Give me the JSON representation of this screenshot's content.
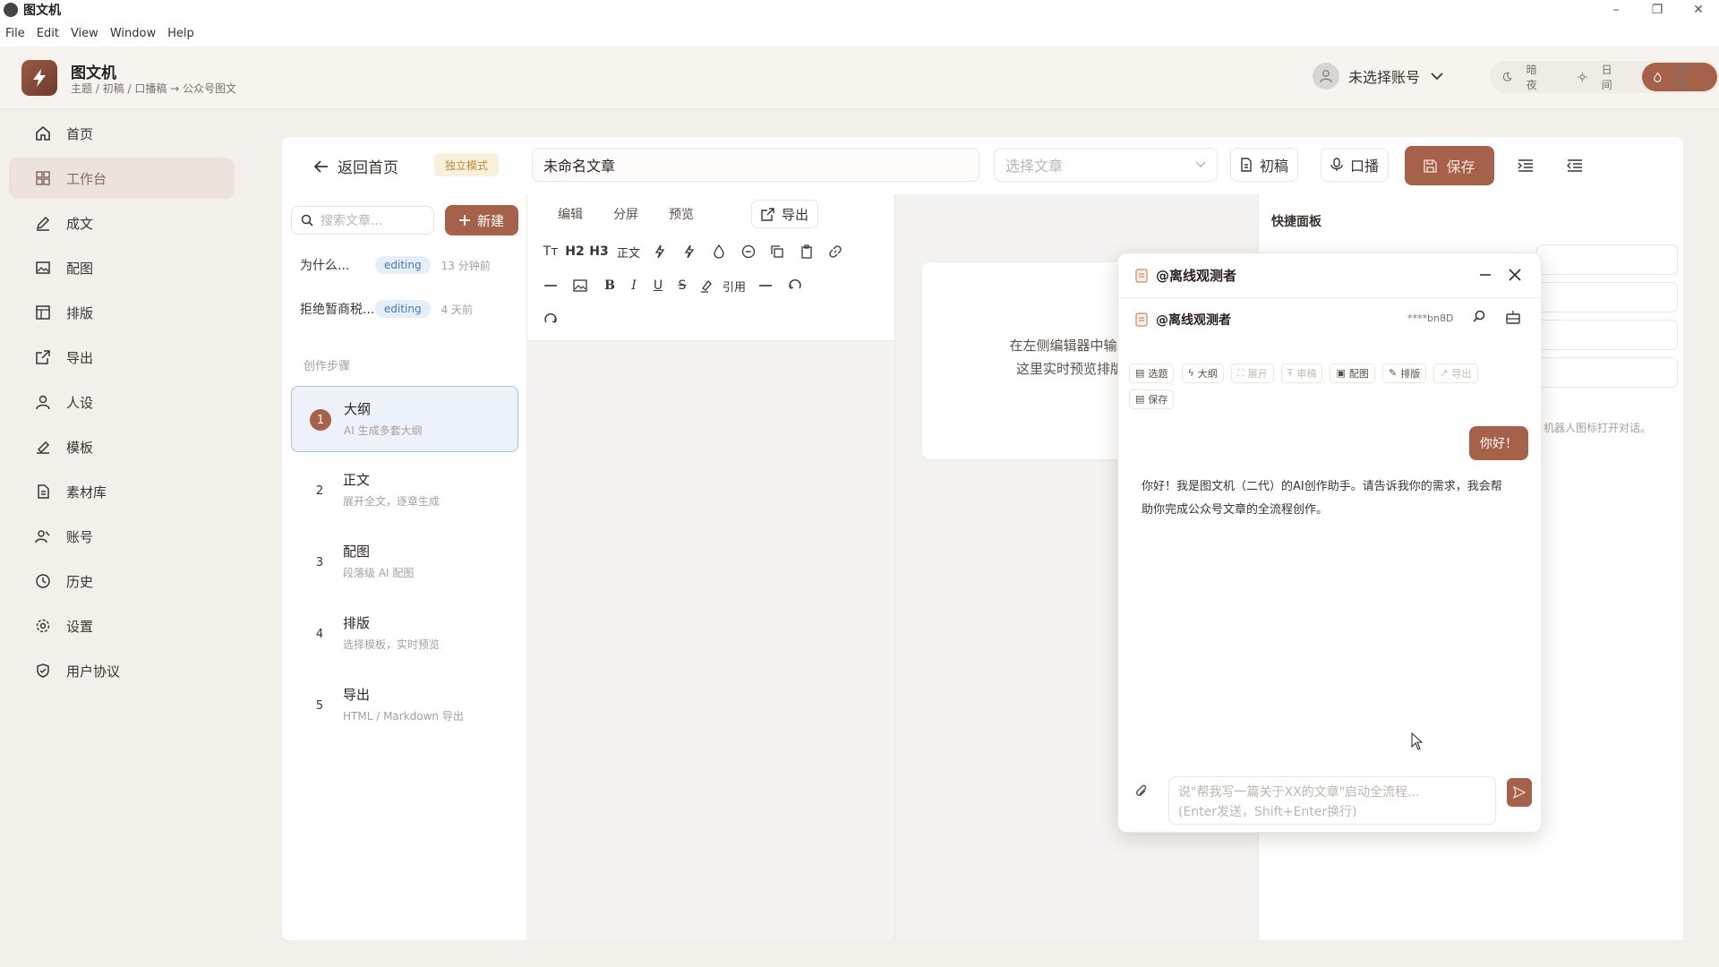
{
  "window": {
    "title": "图文机",
    "minimize": "–",
    "maximize": "❐",
    "close": "✕"
  },
  "menu": [
    "File",
    "Edit",
    "View",
    "Window",
    "Help"
  ],
  "header": {
    "brand": "图文机",
    "breadcrumb": "主题 / 初稿 / 口播稿 → 公众号图文",
    "account": "未选择账号",
    "themes": [
      "暗夜",
      "日间",
      "暖阳"
    ],
    "active_theme": "暖阳"
  },
  "sidebar": {
    "items": [
      {
        "label": "首页",
        "icon": "home-icon"
      },
      {
        "label": "工作台",
        "icon": "grid-icon"
      },
      {
        "label": "成文",
        "icon": "pen-icon"
      },
      {
        "label": "配图",
        "icon": "image-icon"
      },
      {
        "label": "排版",
        "icon": "layout-icon"
      },
      {
        "label": "导出",
        "icon": "export-icon"
      },
      {
        "label": "人设",
        "icon": "person-icon"
      },
      {
        "label": "模板",
        "icon": "template-icon"
      },
      {
        "label": "素材库",
        "icon": "document-icon"
      },
      {
        "label": "账号",
        "icon": "account-icon"
      },
      {
        "label": "历史",
        "icon": "clock-icon"
      },
      {
        "label": "设置",
        "icon": "gear-icon"
      },
      {
        "label": "用户协议",
        "icon": "shield-icon"
      }
    ],
    "active": "工作台"
  },
  "toolbar": {
    "back": "返回首页",
    "mode_badge": "独立模式",
    "title_value": "未命名文章",
    "select_placeholder": "选择文章",
    "draft": "初稿",
    "voice": "口播",
    "save": "保存"
  },
  "articles": {
    "search_placeholder": "搜索文章...",
    "new": "新建",
    "list": [
      {
        "title": "为什么...",
        "status": "editing",
        "time": "13 分钟前"
      },
      {
        "title": "拒绝暂商税...",
        "status": "editing",
        "time": "4 天前"
      }
    ],
    "steps_label": "创作步骤",
    "steps": [
      {
        "num": "1",
        "title": "大纲",
        "desc": "AI 生成多套大纲"
      },
      {
        "num": "2",
        "title": "正文",
        "desc": "展开全文，逐章生成"
      },
      {
        "num": "3",
        "title": "配图",
        "desc": "段落级 AI 配图"
      },
      {
        "num": "4",
        "title": "排版",
        "desc": "选择模板，实时预览"
      },
      {
        "num": "5",
        "title": "导出",
        "desc": "HTML / Markdown 导出"
      }
    ]
  },
  "editor": {
    "tabs": [
      "编辑",
      "分屏",
      "预览"
    ],
    "export": "导出",
    "fmt": {
      "text": "Tт",
      "h2": "H2",
      "h3": "H3",
      "body": "正文",
      "quote": "引用"
    }
  },
  "preview": {
    "line1": "在左侧编辑器中输入",
    "line2": "这里实时预览排版"
  },
  "quick": {
    "title": "快捷面板",
    "hint": "机器人图标打开对话。"
  },
  "chat": {
    "title": "@离线观测者",
    "account": "@离线观测者",
    "masked": "****bn8D",
    "tools": [
      {
        "label": "选题",
        "dim": false
      },
      {
        "label": "大纲",
        "dim": false
      },
      {
        "label": "展开",
        "dim": true
      },
      {
        "label": "审稿",
        "dim": true
      },
      {
        "label": "配图",
        "dim": false
      },
      {
        "label": "排版",
        "dim": false
      },
      {
        "label": "导出",
        "dim": true
      },
      {
        "label": "保存",
        "dim": false
      }
    ],
    "user_msg": "你好！",
    "bot_msg": "你好！我是图文机（二代）的AI创作助手。请告诉我你的需求，我会帮助你完成公众号文章的全流程创作。",
    "input_line1": "说\"帮我写一篇关于XX的文章\"启动全流程...",
    "input_line2": "(Enter发送，Shift+Enter换行)"
  },
  "colors": {
    "accent": "#a6614b",
    "active_nav_bg": "#ebe3dc",
    "badge_bg": "#fbf0dc",
    "status_bg": "#e5eef9"
  }
}
